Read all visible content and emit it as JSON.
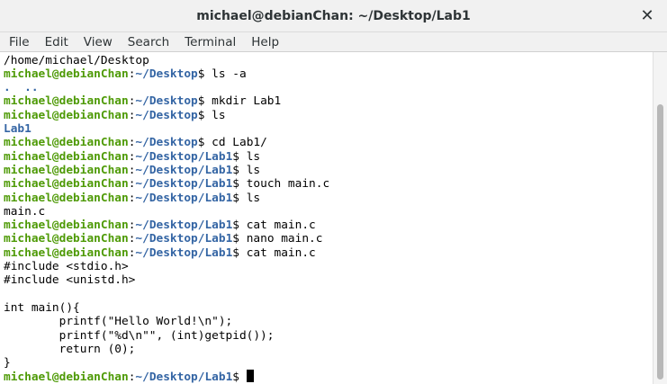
{
  "window": {
    "title": "michael@debianChan: ~/Desktop/Lab1",
    "close_icon": "✕"
  },
  "menubar": {
    "items": [
      "File",
      "Edit",
      "View",
      "Search",
      "Terminal",
      "Help"
    ]
  },
  "terminal": {
    "lines": [
      {
        "type": "output",
        "text": "/home/michael/Desktop"
      },
      {
        "type": "prompt",
        "user": "michael@debianChan",
        "path": "~/Desktop",
        "cmd": " ls -a"
      },
      {
        "type": "dir",
        "text": ".  .."
      },
      {
        "type": "prompt",
        "user": "michael@debianChan",
        "path": "~/Desktop",
        "cmd": " mkdir Lab1"
      },
      {
        "type": "prompt",
        "user": "michael@debianChan",
        "path": "~/Desktop",
        "cmd": " ls"
      },
      {
        "type": "dir",
        "text": "Lab1"
      },
      {
        "type": "prompt",
        "user": "michael@debianChan",
        "path": "~/Desktop",
        "cmd": " cd Lab1/"
      },
      {
        "type": "prompt",
        "user": "michael@debianChan",
        "path": "~/Desktop/Lab1",
        "cmd": " ls"
      },
      {
        "type": "prompt",
        "user": "michael@debianChan",
        "path": "~/Desktop/Lab1",
        "cmd": " ls"
      },
      {
        "type": "prompt",
        "user": "michael@debianChan",
        "path": "~/Desktop/Lab1",
        "cmd": " touch main.c"
      },
      {
        "type": "prompt",
        "user": "michael@debianChan",
        "path": "~/Desktop/Lab1",
        "cmd": " ls"
      },
      {
        "type": "output",
        "text": "main.c"
      },
      {
        "type": "prompt",
        "user": "michael@debianChan",
        "path": "~/Desktop/Lab1",
        "cmd": " cat main.c"
      },
      {
        "type": "prompt",
        "user": "michael@debianChan",
        "path": "~/Desktop/Lab1",
        "cmd": " nano main.c"
      },
      {
        "type": "prompt",
        "user": "michael@debianChan",
        "path": "~/Desktop/Lab1",
        "cmd": " cat main.c"
      },
      {
        "type": "output",
        "text": "#include <stdio.h>"
      },
      {
        "type": "output",
        "text": "#include <unistd.h>"
      },
      {
        "type": "output",
        "text": ""
      },
      {
        "type": "output",
        "text": "int main(){"
      },
      {
        "type": "output",
        "text": "        printf(\"Hello World!\\n\");"
      },
      {
        "type": "output",
        "text": "        printf(\"%d\\n\"\", (int)getpid());"
      },
      {
        "type": "output",
        "text": "        return (0);"
      },
      {
        "type": "output",
        "text": "}"
      },
      {
        "type": "prompt",
        "user": "michael@debianChan",
        "path": "~/Desktop/Lab1",
        "cmd": " ",
        "cursor": true
      }
    ]
  }
}
